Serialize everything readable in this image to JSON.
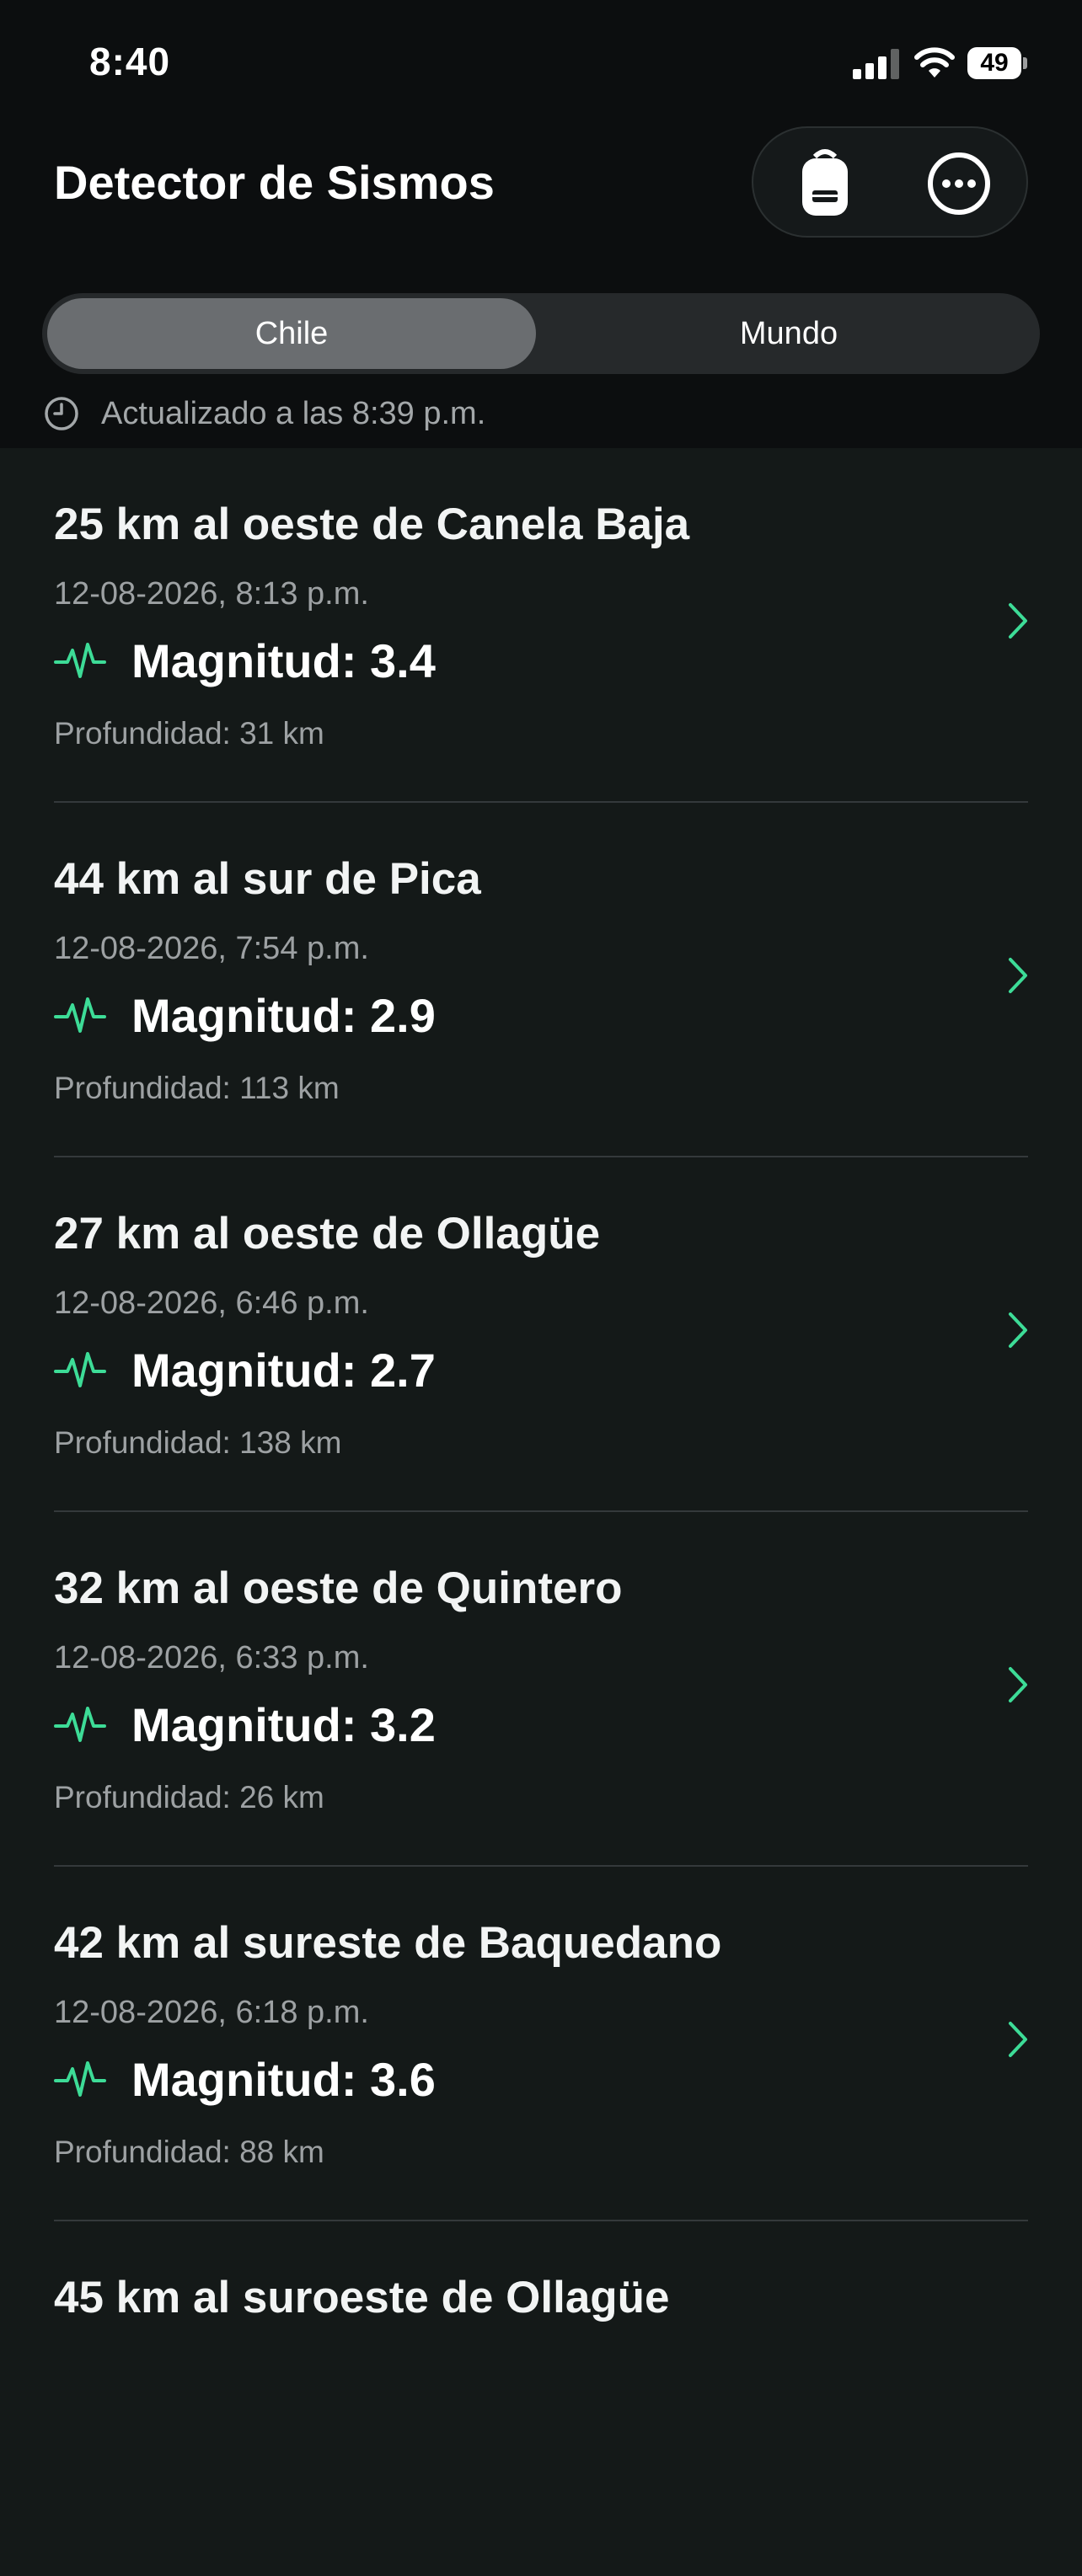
{
  "status_bar": {
    "time": "8:40",
    "battery": "49",
    "icons": [
      "cellular-signal-icon",
      "wifi-icon",
      "battery-icon"
    ]
  },
  "nav": {
    "title": "Detector de Sismos",
    "actions": [
      "backpack-icon",
      "more-ellipsis-icon"
    ]
  },
  "segments": {
    "chile": "Chile",
    "mundo": "Mundo",
    "selected": "Chile"
  },
  "updated": "Actualizado a las 8:39 p.m.",
  "colors": {
    "accent": "#3ddc97",
    "background": "#141918",
    "header": "#0c0e0f",
    "segment_selected": "#6a6d70"
  },
  "events": [
    {
      "place": "25 km al oeste de Canela Baja",
      "date": "12-08-2026, 8:13 p.m.",
      "magnitude": "Magnitud: 3.4",
      "depth": "Profundidad: 31 km"
    },
    {
      "place": "44 km al sur de Pica",
      "date": "12-08-2026, 7:54 p.m.",
      "magnitude": "Magnitud: 2.9",
      "depth": "Profundidad: 113 km"
    },
    {
      "place": "27 km al oeste de Ollagüe",
      "date": "12-08-2026, 6:46 p.m.",
      "magnitude": "Magnitud: 2.7",
      "depth": "Profundidad: 138 km"
    },
    {
      "place": "32 km al oeste de Quintero",
      "date": "12-08-2026, 6:33 p.m.",
      "magnitude": "Magnitud: 3.2",
      "depth": "Profundidad: 26 km"
    },
    {
      "place": "42 km al sureste de Baquedano",
      "date": "12-08-2026, 6:18 p.m.",
      "magnitude": "Magnitud: 3.6",
      "depth": "Profundidad: 88 km"
    },
    {
      "place": "45 km al suroeste de Ollagüe",
      "date": "",
      "magnitude": "",
      "depth": ""
    }
  ]
}
